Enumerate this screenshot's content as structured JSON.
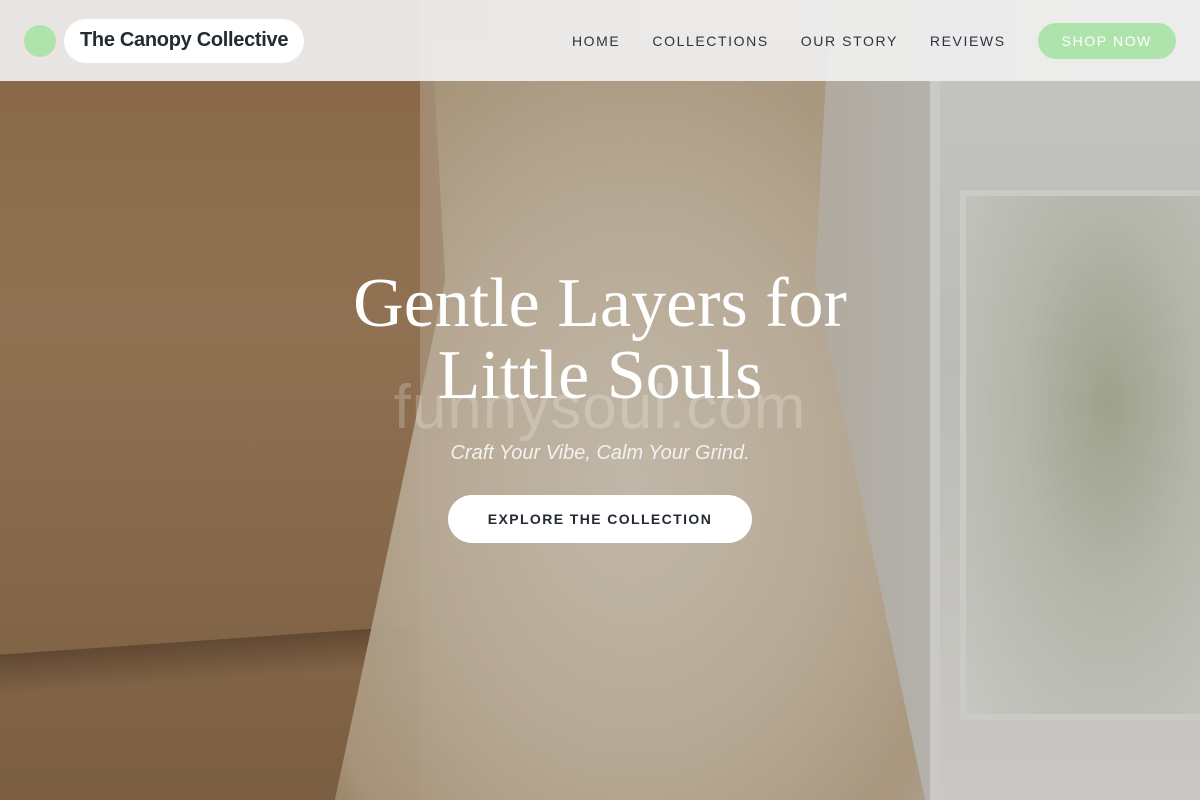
{
  "header": {
    "brand_name": "The Canopy Collective",
    "nav": [
      {
        "label": "HOME"
      },
      {
        "label": "COLLECTIONS"
      },
      {
        "label": "OUR STORY"
      },
      {
        "label": "REVIEWS"
      }
    ],
    "cta_label": "SHOP NOW"
  },
  "hero": {
    "title": "Gentle Layers for Little Souls",
    "subtitle": "Craft Your Vibe, Calm Your Grind.",
    "cta_label": "EXPLORE THE COLLECTION",
    "watermark": "funnysoul.com"
  },
  "colors": {
    "accent": "#aee3ab",
    "text_dark": "#232a33",
    "header_bg": "#f0f0f0"
  },
  "icons": {
    "brand": "circle-logo-icon"
  }
}
